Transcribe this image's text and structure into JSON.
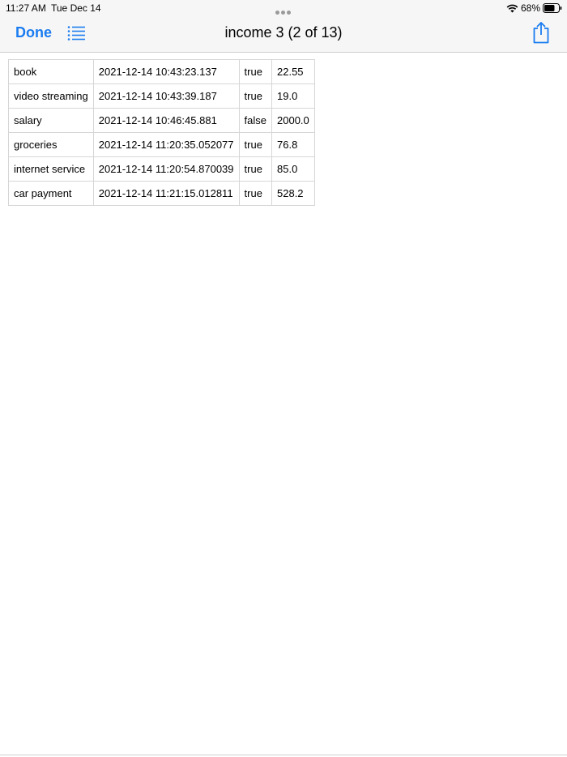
{
  "status_bar": {
    "time": "11:27 AM",
    "date": "Tue Dec 14",
    "battery": "68%"
  },
  "nav": {
    "done_label": "Done",
    "title": "income 3 (2 of 13)",
    "accent_color": "#1a7cf0"
  },
  "table": {
    "rows": [
      [
        "book",
        "2021-12-14 10:43:23.137",
        "true",
        "22.55"
      ],
      [
        "video streaming",
        "2021-12-14 10:43:39.187",
        "true",
        "19.0"
      ],
      [
        "salary",
        "2021-12-14 10:46:45.881",
        "false",
        "2000.0"
      ],
      [
        "groceries",
        "2021-12-14 11:20:35.052077",
        "true",
        "76.8"
      ],
      [
        "internet service",
        "2021-12-14 11:20:54.870039",
        "true",
        "85.0"
      ],
      [
        "car payment",
        "2021-12-14 11:21:15.012811",
        "true",
        "528.2"
      ]
    ]
  }
}
